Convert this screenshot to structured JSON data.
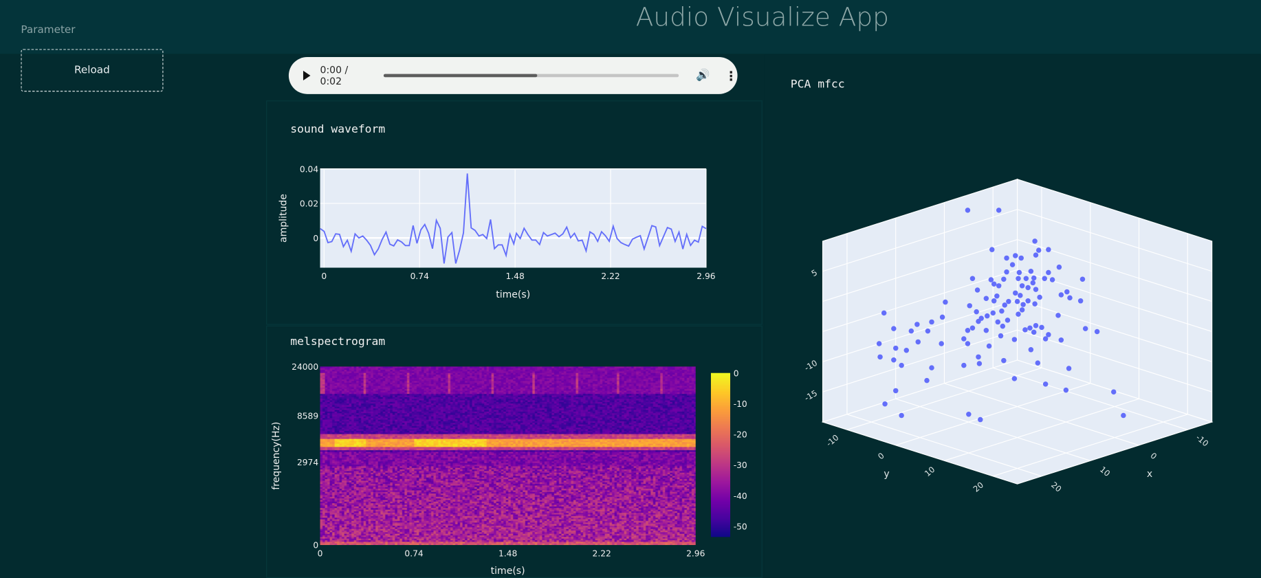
{
  "header": {
    "title": "Audio Visualize App"
  },
  "sidebar": {
    "label": "Parameter",
    "reload_label": "Reload"
  },
  "player": {
    "time": "0:00 / 0:02",
    "buffered_fraction": 0.52,
    "play_icon": "play-icon",
    "volume_icon": "volume-icon",
    "more_icon": "more-vertical-icon"
  },
  "colors": {
    "background": "#032b2f",
    "header": "#04343a",
    "plot_bg": "#e5ecf6",
    "series": "#636efa"
  },
  "chart_data": [
    {
      "type": "line",
      "title": "sound waveform",
      "xlabel": "time(s)",
      "ylabel": "amplitude",
      "xlim": [
        -0.031,
        2.96
      ],
      "ylim": [
        -0.0172,
        0.04
      ],
      "xticks": [
        "0",
        "0.74",
        "1.48",
        "2.22",
        "2.96"
      ],
      "yticks": [
        "0",
        "0.02",
        "0.04"
      ],
      "grid": true,
      "x": [
        -0.03,
        0.0,
        0.03,
        0.06,
        0.09,
        0.12,
        0.15,
        0.18,
        0.21,
        0.24,
        0.27,
        0.3,
        0.33,
        0.36,
        0.39,
        0.42,
        0.45,
        0.48,
        0.51,
        0.54,
        0.57,
        0.6,
        0.63,
        0.66,
        0.69,
        0.72,
        0.75,
        0.78,
        0.81,
        0.84,
        0.87,
        0.9,
        0.93,
        0.96,
        0.99,
        1.02,
        1.05,
        1.08,
        1.11,
        1.14,
        1.17,
        1.2,
        1.23,
        1.26,
        1.29,
        1.32,
        1.35,
        1.38,
        1.41,
        1.44,
        1.47,
        1.49,
        1.52,
        1.55,
        1.58,
        1.61,
        1.64,
        1.67,
        1.7,
        1.73,
        1.76,
        1.79,
        1.82,
        1.85,
        1.88,
        1.91,
        1.94,
        1.97,
        2.0,
        2.03,
        2.06,
        2.09,
        2.12,
        2.15,
        2.18,
        2.21,
        2.24,
        2.27,
        2.3,
        2.33,
        2.36,
        2.39,
        2.42,
        2.45,
        2.48,
        2.51,
        2.54,
        2.57,
        2.6,
        2.63,
        2.66,
        2.69,
        2.72,
        2.75,
        2.78,
        2.81,
        2.84,
        2.87,
        2.9,
        2.93,
        2.96
      ],
      "y": [
        0.0054,
        0.0038,
        -0.0027,
        -0.0021,
        0.0024,
        0.0021,
        -0.005,
        -0.0013,
        -0.0077,
        0.0024,
        0,
        0.0011,
        -0.0013,
        -0.0043,
        -0.0097,
        -0.0063,
        -0.0009,
        0.0034,
        -0.0036,
        -0.0046,
        -0.0011,
        -0.0023,
        -0.0044,
        -0.0044,
        0.0072,
        -0.0031,
        0.0047,
        0.0078,
        0.0027,
        -0.0062,
        0.0102,
        0.0056,
        -0.0148,
        0.0005,
        0.0031,
        -0.0148,
        -0.007,
        0.003,
        0.0373,
        0.0058,
        0.0044,
        0.0011,
        0.002,
        -0.0003,
        0.0107,
        -0.0062,
        -0.004,
        -0.004,
        -0.0101,
        0.0021,
        -0.0035,
        0.0027,
        -0.0003,
        0.0056,
        0.0019,
        -0.0012,
        -0.0012,
        -0.0038,
        0.0031,
        0.0011,
        0.0019,
        0.0028,
        0.0007,
        0.0024,
        0.0063,
        0.0001,
        0.0027,
        -0.0017,
        -0.0013,
        -0.0075,
        0.0035,
        0.0021,
        -0.002,
        0.0036,
        0.0013,
        -0.0019,
        0.0068,
        -0.0003,
        -0.0027,
        -0.0038,
        -0.0047,
        -0.0007,
        0.0004,
        0.0013,
        -0.0064,
        0.0004,
        0.0071,
        0.0064,
        -0.0044,
        0.0008,
        0.006,
        0.0051,
        -0.002,
        0.0034,
        -0.0064,
        0.0021,
        -0.0043,
        -0.0013,
        -0.0024,
        0.0067,
        0.0054
      ]
    },
    {
      "type": "heatmap",
      "title": "melspectrogram",
      "xlabel": "time(s)",
      "ylabel": "frequency(Hz)",
      "xlim": [
        0,
        2.96
      ],
      "ylim_hz": [
        0,
        24000
      ],
      "y_scale": "mel",
      "xticks": [
        "0",
        "0.74",
        "1.48",
        "2.22",
        "2.96"
      ],
      "yticks": [
        "0",
        "2974",
        "8589",
        "24000"
      ],
      "colorscale": "plasma",
      "zlim": [
        -53.5,
        0
      ],
      "colorbar_ticks": [
        "0",
        "-10",
        "-20",
        "-30",
        "-40",
        "-50"
      ],
      "dominant_band_hz": 4800
    },
    {
      "type": "scatter3d",
      "title": "PCA mfcc",
      "xlabel": "x",
      "ylabel": "y",
      "xticks": [
        "-10",
        "0",
        "10",
        "20"
      ],
      "yticks": [
        "-10",
        "0",
        "10",
        "20"
      ],
      "zticks": [
        "5",
        "-10",
        "-15"
      ],
      "points": [
        [
          0.1,
          -10.1,
          10
        ],
        [
          -3.1,
          -6.9,
          10
        ],
        [
          3.2,
          6.8,
          10.0
        ],
        [
          7.6,
          2.4,
          8.6
        ],
        [
          2.8,
          7.2,
          8.5
        ],
        [
          1.8,
          8.2,
          8.6
        ],
        [
          5.2,
          4.8,
          7.6
        ],
        [
          3.1,
          6.9,
          7.7
        ],
        [
          6.1,
          3.9,
          7.2
        ],
        [
          4.6,
          5.4,
          7.2
        ],
        [
          5.5,
          4.5,
          6.1
        ],
        [
          0.7,
          9.3,
          5.7
        ],
        [
          6.1,
          3.9,
          4.9
        ],
        [
          4.8,
          5.2,
          4.8
        ],
        [
          3.6,
          6.4,
          5.0
        ],
        [
          1.8,
          8.2,
          4.8
        ],
        [
          9.6,
          0.4,
          3.8
        ],
        [
          7.7,
          2.3,
          3.6
        ],
        [
          6.4,
          3.6,
          3.7
        ],
        [
          4.9,
          5.1,
          3.8
        ],
        [
          4.1,
          5.9,
          3.8
        ],
        [
          3.3,
          6.7,
          3.9
        ],
        [
          2.2,
          7.8,
          3.8
        ],
        [
          1.4,
          8.6,
          3.6
        ],
        [
          -1.7,
          11.7,
          3.7
        ],
        [
          7.4,
          2.6,
          2.9
        ],
        [
          6.9,
          3.1,
          2.6
        ],
        [
          4.5,
          5.5,
          2.6
        ],
        [
          3.4,
          6.6,
          3.1
        ],
        [
          3.9,
          6.1,
          2.3
        ],
        [
          3.1,
          6.9,
          2.0
        ],
        [
          9.1,
          0.9,
          1.9
        ],
        [
          5.2,
          4.8,
          1.4
        ],
        [
          -0.1,
          10.1,
          1.6
        ],
        [
          0.5,
          9.5,
          1.1
        ],
        [
          7.1,
          2.9,
          0.9
        ],
        [
          4.7,
          5.3,
          1.0
        ],
        [
          2.7,
          7.3,
          0.7
        ],
        [
          8.2,
          1.8,
          0.5
        ],
        [
          -0.4,
          10.4,
          0.6
        ],
        [
          -1.5,
          11.5,
          0.1
        ],
        [
          7.4,
          2.6,
          0.1
        ],
        [
          5.9,
          4.1,
          0.0
        ],
        [
          5.0,
          5.0,
          0.0
        ],
        [
          3.9,
          6.1,
          0.1
        ],
        [
          12.4,
          -2.4,
          -0.1
        ],
        [
          9.9,
          0.1,
          -0.7
        ],
        [
          6.3,
          3.7,
          -0.6
        ],
        [
          4.4,
          5.6,
          -0.5
        ],
        [
          3.2,
          6.8,
          -0.4
        ],
        [
          9.2,
          0.8,
          -1.7
        ],
        [
          7.5,
          2.5,
          -1.9
        ],
        [
          6.6,
          3.4,
          -1.6
        ],
        [
          4.5,
          5.5,
          -1.4
        ],
        [
          4.9,
          5.1,
          -2.1
        ],
        [
          0.8,
          9.2,
          -2.3
        ],
        [
          18.7,
          -8.7,
          -1.9
        ],
        [
          12.7,
          -2.7,
          -2.6
        ],
        [
          8.1,
          1.9,
          -2.4
        ],
        [
          8.7,
          1.3,
          -2.8
        ],
        [
          13.8,
          -3.8,
          -3.4
        ],
        [
          9.0,
          1.0,
          -3.3
        ],
        [
          7.0,
          3.0,
          -3.4
        ],
        [
          6.0,
          4.0,
          -3.1
        ],
        [
          15.3,
          -5.3,
          -3.8
        ],
        [
          6.5,
          3.5,
          -4.1
        ],
        [
          9.6,
          0.4,
          -4.4
        ],
        [
          17.7,
          -7.7,
          -4.5
        ],
        [
          -2.0,
          12.0,
          -4.5
        ],
        [
          3.7,
          6.3,
          -4.4
        ],
        [
          3.1,
          6.9,
          -4.0
        ],
        [
          2.5,
          7.5,
          -4.3
        ],
        [
          15.9,
          -5.9,
          -4.9
        ],
        [
          14.2,
          -4.2,
          -4.9
        ],
        [
          10.1,
          -0.1,
          -4.8
        ],
        [
          8.2,
          1.8,
          -4.8
        ],
        [
          4.2,
          5.8,
          -4.7
        ],
        [
          3.3,
          6.7,
          -5.1
        ],
        [
          -3.2,
          13.2,
          -5.0
        ],
        [
          6.7,
          3.3,
          -5.7
        ],
        [
          1.8,
          8.2,
          -5.5
        ],
        [
          10.5,
          -0.5,
          -6.2
        ],
        [
          5.3,
          4.7,
          -6.3
        ],
        [
          2.1,
          7.9,
          -6.2
        ],
        [
          0.5,
          9.5,
          -6.4
        ],
        [
          15.2,
          -5.2,
          -6.7
        ],
        [
          19.2,
          -9.2,
          -7.0
        ],
        [
          12.8,
          -2.8,
          -7.0
        ],
        [
          10.1,
          -0.1,
          -7.0
        ],
        [
          7.9,
          2.1,
          -7.4
        ],
        [
          17.4,
          -7.6,
          -7.8
        ],
        [
          16.4,
          -6.4,
          -8.1
        ],
        [
          3.6,
          6.4,
          -8.0
        ],
        [
          19.1,
          -9.1,
          -9.2
        ],
        [
          9.0,
          1.0,
          -9.2
        ],
        [
          17.7,
          -7.7,
          -9.7
        ],
        [
          6.4,
          3.6,
          -9.8
        ],
        [
          2.9,
          7.1,
          -10.2
        ],
        [
          8.9,
          1.1,
          -10.3
        ],
        [
          16.9,
          -6.9,
          -10.6
        ],
        [
          10.5,
          -0.5,
          -10.6
        ],
        [
          13.8,
          -3.8,
          -11.0
        ],
        [
          -0.3,
          10.3,
          -11.1
        ],
        [
          5.3,
          4.7,
          -12.8
        ],
        [
          14.3,
          -4.3,
          -13.1
        ],
        [
          2.1,
          7.9,
          -13.7
        ],
        [
          17.5,
          -7.5,
          -14.8
        ],
        [
          0.0,
          10.0,
          -14.7
        ],
        [
          -4.9,
          14.9,
          -15.0
        ],
        [
          18.6,
          -8.6,
          -17.0
        ],
        [
          10.0,
          0.0,
          -18.7
        ],
        [
          16.9,
          -6.9,
          -18.9
        ],
        [
          8.8,
          1.2,
          -19.6
        ],
        [
          -5.9,
          15.9,
          -18.9
        ]
      ]
    }
  ]
}
